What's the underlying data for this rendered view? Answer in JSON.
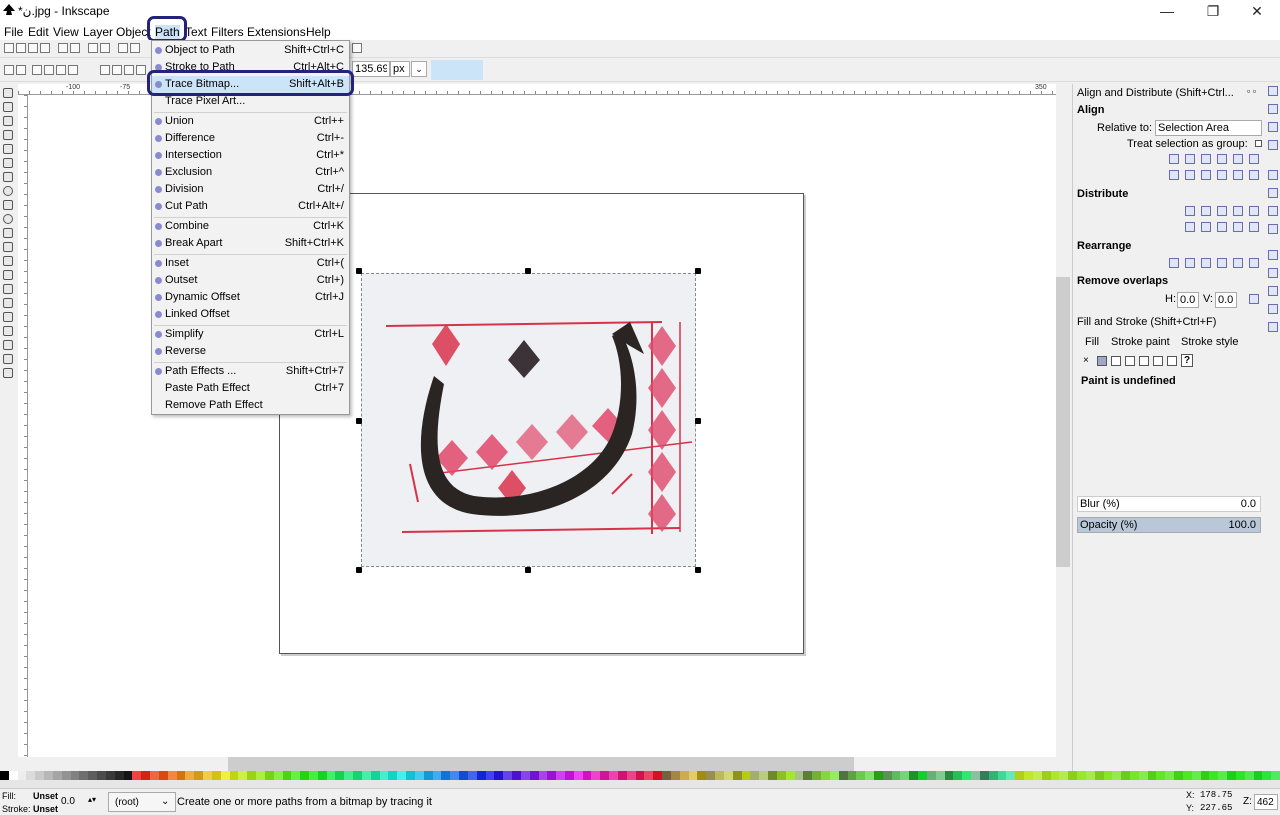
{
  "window": {
    "title": "*ن.jpg - Inkscape",
    "minimize": "—",
    "restore": "❐",
    "close": "✕"
  },
  "menubar": [
    "File",
    "Edit",
    "View",
    "Layer",
    "Object",
    "Path",
    "Text",
    "Filters",
    "Extensions",
    "Help"
  ],
  "toolbar": {
    "w_value": "135.693",
    "unit": "px"
  },
  "ruler": [
    "-100",
    "-75",
    "350"
  ],
  "path_menu": [
    {
      "label": "Object to Path",
      "shortcut": "Shift+Ctrl+C"
    },
    {
      "label": "Stroke to Path",
      "shortcut": "Ctrl+Alt+C"
    },
    {
      "label": "Trace Bitmap...",
      "shortcut": "Shift+Alt+B",
      "highlighted": true
    },
    {
      "label": "Trace Pixel Art...",
      "shortcut": ""
    },
    {
      "label": "Union",
      "shortcut": "Ctrl++"
    },
    {
      "label": "Difference",
      "shortcut": "Ctrl+-"
    },
    {
      "label": "Intersection",
      "shortcut": "Ctrl+*"
    },
    {
      "label": "Exclusion",
      "shortcut": "Ctrl+^"
    },
    {
      "label": "Division",
      "shortcut": "Ctrl+/"
    },
    {
      "label": "Cut Path",
      "shortcut": "Ctrl+Alt+/"
    },
    {
      "label": "Combine",
      "shortcut": "Ctrl+K"
    },
    {
      "label": "Break Apart",
      "shortcut": "Shift+Ctrl+K"
    },
    {
      "label": "Inset",
      "shortcut": "Ctrl+("
    },
    {
      "label": "Outset",
      "shortcut": "Ctrl+)"
    },
    {
      "label": "Dynamic Offset",
      "shortcut": "Ctrl+J"
    },
    {
      "label": "Linked Offset",
      "shortcut": ""
    },
    {
      "label": "Simplify",
      "shortcut": "Ctrl+L"
    },
    {
      "label": "Reverse",
      "shortcut": ""
    },
    {
      "label": "Path Effects ...",
      "shortcut": "Shift+Ctrl+7"
    },
    {
      "label": "Paste Path Effect",
      "shortcut": "Ctrl+7"
    },
    {
      "label": "Remove Path Effect",
      "shortcut": ""
    }
  ],
  "align_panel": {
    "title": "Align and Distribute (Shift+Ctrl...",
    "align": "Align",
    "relative_label": "Relative to:",
    "relative_value": "Selection Area",
    "treat_group": "Treat selection as group:",
    "distribute": "Distribute",
    "rearrange": "Rearrange",
    "remove_overlaps": "Remove overlaps",
    "h_label": "H:",
    "h_value": "0.0",
    "v_label": "V:",
    "v_value": "0.0"
  },
  "fill_panel": {
    "title": "Fill and Stroke (Shift+Ctrl+F)",
    "tabs": [
      "Fill",
      "Stroke paint",
      "Stroke style"
    ],
    "paint_state": "Paint is undefined",
    "blur_label": "Blur (%)",
    "blur_value": "0.0",
    "opacity_label": "Opacity (%)",
    "opacity_value": "100.0"
  },
  "status": {
    "fill_label": "Fill:",
    "fill_value": "Unset",
    "stroke_label": "Stroke:",
    "stroke_value": "Unset",
    "stroke_width": "0.0",
    "layer": "(root)",
    "message": "Create one or more paths from a bitmap by tracing it",
    "x_label": "X:",
    "x_value": "178.75",
    "y_label": "Y:",
    "y_value": "227.65",
    "zoom_label": "Z:",
    "zoom_value": "462"
  },
  "colors": {
    "accent": "#23237a",
    "highlight": "#cce4f7",
    "calligraphy_red": "#d8324a",
    "ink": "#2a2522"
  }
}
